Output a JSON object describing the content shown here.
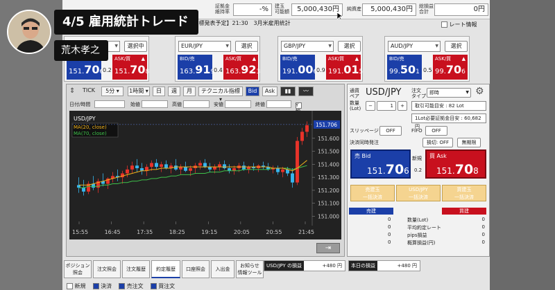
{
  "overlay": {
    "title": "4/5 雇用統計トレード",
    "presenter": "荒木孝之"
  },
  "summary": {
    "margin_ratio_label": "証拠金\n維持率",
    "margin_ratio_value": "-%",
    "available_label": "建玉\n可能額",
    "available_value": "5,000,430円",
    "net_assets_label": "純資産",
    "net_assets_value": "5,000,430円",
    "total_pnl_label": "総損益\n合計",
    "total_pnl_value": "0円",
    "rate_info_label": "レート情報"
  },
  "info_bar": "1:15 【指標発表予定】21:30　3月米雇用統計",
  "panels": [
    {
      "pair": "USD/JPY",
      "button": "選択中",
      "bid_label": "BID/売",
      "bid_main": "151.",
      "bid_big": "70",
      "bid_sub": "6",
      "spread": "0.2",
      "ask_label": "ASK/買",
      "ask_main": "151.",
      "ask_big": "70",
      "ask_sub": "8"
    },
    {
      "pair": "EUR/JPY",
      "button": "選択",
      "bid_label": "BID/売",
      "bid_main": "163.",
      "bid_big": "91",
      "bid_sub": "9",
      "spread": "0.4",
      "ask_label": "ASK/買",
      "ask_main": "163.",
      "ask_big": "92",
      "ask_sub": "3"
    },
    {
      "pair": "GBP/JPY",
      "button": "選択",
      "bid_label": "BID/売",
      "bid_main": "191.",
      "bid_big": "00",
      "bid_sub": "6",
      "spread": "0.9",
      "ask_label": "ASK/買",
      "ask_main": "191.",
      "ask_big": "01",
      "ask_sub": "5"
    },
    {
      "pair": "AUD/JPY",
      "button": "選択",
      "bid_label": "BID/売",
      "bid_main": "99.",
      "bid_big": "50",
      "bid_sub": "1",
      "spread": "0.5",
      "ask_label": "ASK/買",
      "ask_main": "99.",
      "ask_big": "70",
      "ask_sub": "6"
    }
  ],
  "chart_toolbar": {
    "tick": "TICK",
    "interval": "5分",
    "hour1": "1時間",
    "day": "日",
    "week": "週",
    "month": "月",
    "technical": "テクニカル指標",
    "bid": "Bid",
    "ask": "Ask"
  },
  "ohlc": {
    "datetime_label": "日付/時間",
    "open_label": "始値",
    "high_label": "高値",
    "low_label": "安値",
    "close_label": "終値",
    "y_fixed_label": "Y軸固定"
  },
  "chart_data": {
    "type": "candlestick",
    "symbol": "USD/JPY",
    "legend": [
      "MA(20, close)",
      "MA(70, close)"
    ],
    "x_ticks": [
      "15:55",
      "16:45",
      "17:35",
      "18:25",
      "19:15",
      "20:05",
      "20:55",
      "21:45"
    ],
    "y_ticks": [
      151.6,
      151.5,
      151.4,
      151.3,
      151.2,
      151.1,
      151.0
    ],
    "ylim": [
      150.96,
      151.78
    ],
    "current_price": "151.706",
    "colors": {
      "up": "#e8332a",
      "down": "#37b6ef",
      "ma20": "#f2b31a",
      "ma70": "#3ec24a",
      "price_tag": "#1b3fa8"
    },
    "candles": [
      [
        151.24,
        151.3,
        151.18,
        151.22
      ],
      [
        151.22,
        151.28,
        151.16,
        151.19
      ],
      [
        151.19,
        151.27,
        151.17,
        151.25
      ],
      [
        151.25,
        151.31,
        151.2,
        151.22
      ],
      [
        151.22,
        151.29,
        151.18,
        151.27
      ],
      [
        151.27,
        151.33,
        151.23,
        151.25
      ],
      [
        151.25,
        151.3,
        151.21,
        151.29
      ],
      [
        151.29,
        151.34,
        151.26,
        151.31
      ],
      [
        151.31,
        151.36,
        151.27,
        151.3
      ],
      [
        151.3,
        151.35,
        151.25,
        151.33
      ],
      [
        151.33,
        151.39,
        151.3,
        151.36
      ],
      [
        151.36,
        151.42,
        151.33,
        151.39
      ],
      [
        151.39,
        151.44,
        151.34,
        151.37
      ],
      [
        151.37,
        151.41,
        151.32,
        151.35
      ],
      [
        151.35,
        151.4,
        151.31,
        151.38
      ],
      [
        151.38,
        151.43,
        151.35,
        151.41
      ],
      [
        151.41,
        151.44,
        151.36,
        151.38
      ],
      [
        151.38,
        151.42,
        151.34,
        151.4
      ],
      [
        151.4,
        151.43,
        151.36,
        151.37
      ],
      [
        151.37,
        151.41,
        151.33,
        151.39
      ],
      [
        151.39,
        151.44,
        151.35,
        151.36
      ],
      [
        151.36,
        151.4,
        151.32,
        151.38
      ],
      [
        151.38,
        151.42,
        151.34,
        151.35
      ],
      [
        151.35,
        151.39,
        151.31,
        151.37
      ],
      [
        151.37,
        151.41,
        151.33,
        151.39
      ],
      [
        151.39,
        151.43,
        151.36,
        151.41
      ],
      [
        151.41,
        151.44,
        151.37,
        151.38
      ],
      [
        151.38,
        151.41,
        151.34,
        151.36
      ],
      [
        151.36,
        151.4,
        151.33,
        151.38
      ],
      [
        151.38,
        151.42,
        151.35,
        151.4
      ],
      [
        151.4,
        151.43,
        151.36,
        151.37
      ],
      [
        151.37,
        151.4,
        151.33,
        151.35
      ],
      [
        151.35,
        151.39,
        151.32,
        151.37
      ],
      [
        151.37,
        151.41,
        151.34,
        151.39
      ],
      [
        151.39,
        151.42,
        151.35,
        151.36
      ],
      [
        151.36,
        151.39,
        151.33,
        151.38
      ],
      [
        151.38,
        151.41,
        151.35,
        151.37
      ],
      [
        151.37,
        151.4,
        151.34,
        151.39
      ],
      [
        151.39,
        151.42,
        151.36,
        151.38
      ],
      [
        151.38,
        151.41,
        151.35,
        151.36
      ],
      [
        151.36,
        151.39,
        151.33,
        151.37
      ],
      [
        151.37,
        151.39,
        151.32,
        151.34
      ],
      [
        151.34,
        151.38,
        151.3,
        151.36
      ],
      [
        151.36,
        151.38,
        151.31,
        151.33
      ],
      [
        151.33,
        151.37,
        151.22,
        151.26
      ],
      [
        151.26,
        151.61,
        151.24,
        151.58
      ],
      [
        151.58,
        151.68,
        151.55,
        151.65
      ],
      [
        151.65,
        151.73,
        151.61,
        151.7
      ]
    ],
    "ma20": [
      151.24,
      151.24,
      151.24,
      151.25,
      151.26,
      151.27,
      151.28,
      151.29,
      151.3,
      151.31,
      151.32,
      151.33,
      151.34,
      151.35,
      151.35,
      151.36,
      151.36,
      151.37,
      151.37,
      151.37,
      151.38,
      151.38,
      151.38,
      151.38,
      151.38,
      151.38,
      151.38,
      151.38,
      151.38,
      151.38,
      151.38,
      151.38,
      151.38,
      151.38,
      151.38,
      151.38,
      151.38,
      151.38,
      151.38,
      151.38,
      151.37,
      151.37,
      151.37,
      151.36,
      151.35,
      151.37,
      151.4,
      151.43
    ],
    "ma70": [
      151.22,
      151.22,
      151.23,
      151.23,
      151.23,
      151.24,
      151.24,
      151.25,
      151.25,
      151.26,
      151.26,
      151.27,
      151.27,
      151.28,
      151.28,
      151.29,
      151.29,
      151.3,
      151.3,
      151.31,
      151.31,
      151.32,
      151.32,
      151.32,
      151.33,
      151.33,
      151.33,
      151.34,
      151.34,
      151.34,
      151.35,
      151.35,
      151.35,
      151.35,
      151.36,
      151.36,
      151.36,
      151.36,
      151.36,
      151.36,
      151.37,
      151.37,
      151.37,
      151.37,
      151.36,
      151.37,
      151.38,
      151.39
    ]
  },
  "order": {
    "pair_label": "通貨\nペア",
    "pair": "USD/JPY",
    "order_type_label": "注文\nタイプ",
    "order_type": "即時",
    "qty_label": "数量\n(Lot)",
    "qty_value": "1",
    "minus": "−",
    "plus": "+",
    "tradeable_label": "取引可能目安 : 82 Lot",
    "margin_label": "1Lot必要証拠金目安 : 60,682円",
    "slippage_label": "スリッページ",
    "slippage_value": "OFF",
    "fifo_label": "FIFO",
    "fifo_value": "OFF",
    "settle_simul_label": "決済同時発注",
    "settle_simul_value": "損切: OFF",
    "expiry_value": "無期限",
    "sell_label": "売 Bid",
    "sell_main": "151.",
    "sell_big": "70",
    "sell_sub": "6",
    "new_label": "新規",
    "spread": "0.2",
    "buy_label": "買 Ask",
    "buy_main": "151.",
    "buy_big": "70",
    "buy_sub": "8",
    "settle_sell_1": "売建玉",
    "settle_sell_2": "一括決済",
    "settle_all_1": "USD/JPY",
    "settle_all_2": "一括決済",
    "settle_buy_1": "買建玉",
    "settle_buy_2": "一括決済",
    "pos_sell_head": "売建",
    "pos_buy_head": "買建",
    "rows": [
      {
        "label": "数量(Lot)",
        "sell": "0",
        "buy": "0"
      },
      {
        "label": "平均約定レート",
        "sell": "0",
        "buy": "0"
      },
      {
        "label": "pips損益",
        "sell": "0",
        "buy": "0"
      },
      {
        "label": "概算損益(円)",
        "sell": "0",
        "buy": "0"
      }
    ]
  },
  "bottom_tabs": [
    "ポジション\n照会",
    "注文照会",
    "注文履歴",
    "約定履歴",
    "口座照会",
    "入出金",
    "お知らせ\n情報ツール"
  ],
  "pnl": {
    "pair_label": "USD/JPY の損益",
    "pair_value": "+480 円",
    "today_label": "本日の損益",
    "today_value": "+480 円"
  },
  "filters": [
    "新規",
    "決済",
    "売注文",
    "買注文"
  ]
}
